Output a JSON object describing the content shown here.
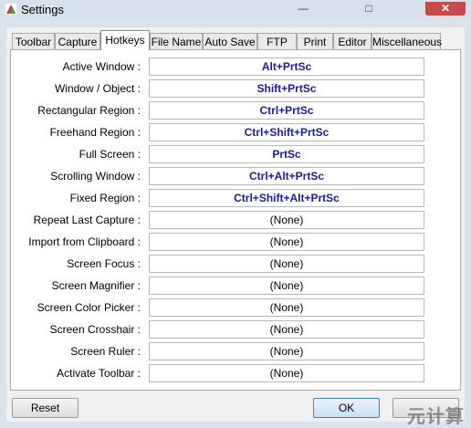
{
  "window": {
    "title": "Settings",
    "min_glyph": "—",
    "max_glyph": "□",
    "close_glyph": "✕"
  },
  "tabs": [
    {
      "label": "Toolbar"
    },
    {
      "label": "Capture"
    },
    {
      "label": "Hotkeys",
      "active": true
    },
    {
      "label": "File Name"
    },
    {
      "label": "Auto Save"
    },
    {
      "label": "FTP"
    },
    {
      "label": "Print"
    },
    {
      "label": "Editor"
    },
    {
      "label": "Miscellaneous"
    }
  ],
  "hotkeys": [
    {
      "label": "Active Window :",
      "value": "Alt+PrtSc"
    },
    {
      "label": "Window / Object :",
      "value": "Shift+PrtSc"
    },
    {
      "label": "Rectangular Region :",
      "value": "Ctrl+PrtSc"
    },
    {
      "label": "Freehand Region :",
      "value": "Ctrl+Shift+PrtSc"
    },
    {
      "label": "Full Screen :",
      "value": "PrtSc"
    },
    {
      "label": "Scrolling Window :",
      "value": "Ctrl+Alt+PrtSc"
    },
    {
      "label": "Fixed Region :",
      "value": "Ctrl+Shift+Alt+PrtSc"
    },
    {
      "label": "Repeat Last Capture :",
      "value": "(None)"
    },
    {
      "label": "Import from Clipboard :",
      "value": "(None)"
    },
    {
      "label": "Screen Focus :",
      "value": "(None)"
    },
    {
      "label": "Screen Magnifier :",
      "value": "(None)"
    },
    {
      "label": "Screen Color Picker :",
      "value": "(None)"
    },
    {
      "label": "Screen Crosshair :",
      "value": "(None)"
    },
    {
      "label": "Screen Ruler :",
      "value": "(None)"
    },
    {
      "label": "Activate Toolbar :",
      "value": "(None)"
    }
  ],
  "buttons": {
    "reset": "Reset",
    "ok": "OK",
    "cancel": "元计算"
  },
  "colors": {
    "assigned_hotkey": "#1a1aa0",
    "close_button": "#c64a4a"
  }
}
